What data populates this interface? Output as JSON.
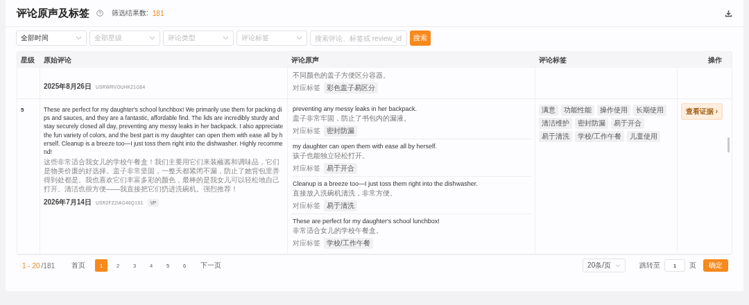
{
  "header": {
    "title": "评论原声及标签",
    "result_label": "筛选结果数:",
    "result_count": "181"
  },
  "filters": [
    {
      "value": "全部时间"
    },
    {
      "placeholder": "全部星级"
    },
    {
      "placeholder": "评论类型"
    },
    {
      "placeholder": "评论标签"
    }
  ],
  "search": {
    "placeholder": "搜索评论、标签或 review_id",
    "button": "搜索"
  },
  "table": {
    "columns": [
      "星级",
      "原始评论",
      "评论原声",
      "评论标签",
      "操作"
    ],
    "rows": [
      {
        "date": "2025年8月26日",
        "user_id": "USRWRVOUHK21G64",
        "voices": [
          {
            "translation": "不同颜色的盖子方便区分容器。",
            "tag_label": "对应标签",
            "tags": [
              "彩色盖子易区分"
            ]
          }
        ]
      },
      {
        "rating": "5",
        "review_text": " These are perfect for my daughter's school lunchbox! We primarily use them for packing dips and sauces, and they are a fantastic, affordable find. The lids are incredibly sturdy and stay securely closed all day, preventing any messy leaks in her backpack. I also appreciate the fun variety of colors, and the best part is my daughter can open them with ease all by herself. Cleanup is a breeze too—I just toss them right into the dishwasher. Highly recommend!",
        "translation": "这些非常适合我女儿的学校午餐盒！我们主要用它们来装蘸酱和调味品，它们是物美价廉的好选择。盖子非常坚固，一整天都紧闭不漏，防止了她背包里弄得到处都是。我也喜欢它们丰富多彩的颜色，最棒的是我女儿可以轻松地自己打开。清洁也很方便——我直接把它们扔进洗碗机。强烈推荐！",
        "date": "2026年7月14日",
        "user_id": "USR2FZ2IAG46Q1S1",
        "badge": "VP",
        "voices": [
          {
            "text": "preventing any messy leaks in her backpack.",
            "translation": "盖子非常牢固，防止了书包内的漏液。",
            "tag_label": "对应标签",
            "tags": [
              "密封防漏"
            ]
          },
          {
            "text": "my daughter can open them with ease all by herself.",
            "translation": "孩子也能独立轻松打开。",
            "tag_label": "对应标签",
            "tags": [
              "易于开合"
            ]
          },
          {
            "text": "Cleanup is a breeze too—I just toss them right into the dishwasher.",
            "translation": "直接放入洗碗机清洗，非常方便。",
            "tag_label": "对应标签",
            "tags": [
              "易于清洗"
            ]
          },
          {
            "text": "These are perfect for my daughter's school lunchbox!",
            "translation": "非常适合女儿的学校午餐盒。",
            "tag_label": "对应标签",
            "tags": [
              "学校/工作午餐"
            ]
          }
        ],
        "tags": [
          "满意",
          "功能性能",
          "操作使用",
          "长期使用",
          "清洁维护",
          "密封防漏",
          "易于开合",
          "易于清洗",
          "学校/工作午餐",
          "儿童使用"
        ],
        "action": "查看证据 ›"
      }
    ]
  },
  "pagination": {
    "range": "1 - 20",
    "total": "/181",
    "first": "首页",
    "pages": [
      {
        "label": "1",
        "selected": true
      },
      {
        "label": "2",
        "selected": false
      },
      {
        "label": "3",
        "selected": false
      },
      {
        "label": "4",
        "selected": false
      },
      {
        "label": "5",
        "selected": false
      },
      {
        "label": "6",
        "selected": false
      }
    ],
    "next": "下一页",
    "page_size": "20条/页",
    "jump_label": "跳转至",
    "jump_value": "1",
    "page_unit": "页",
    "confirm": "确定"
  }
}
